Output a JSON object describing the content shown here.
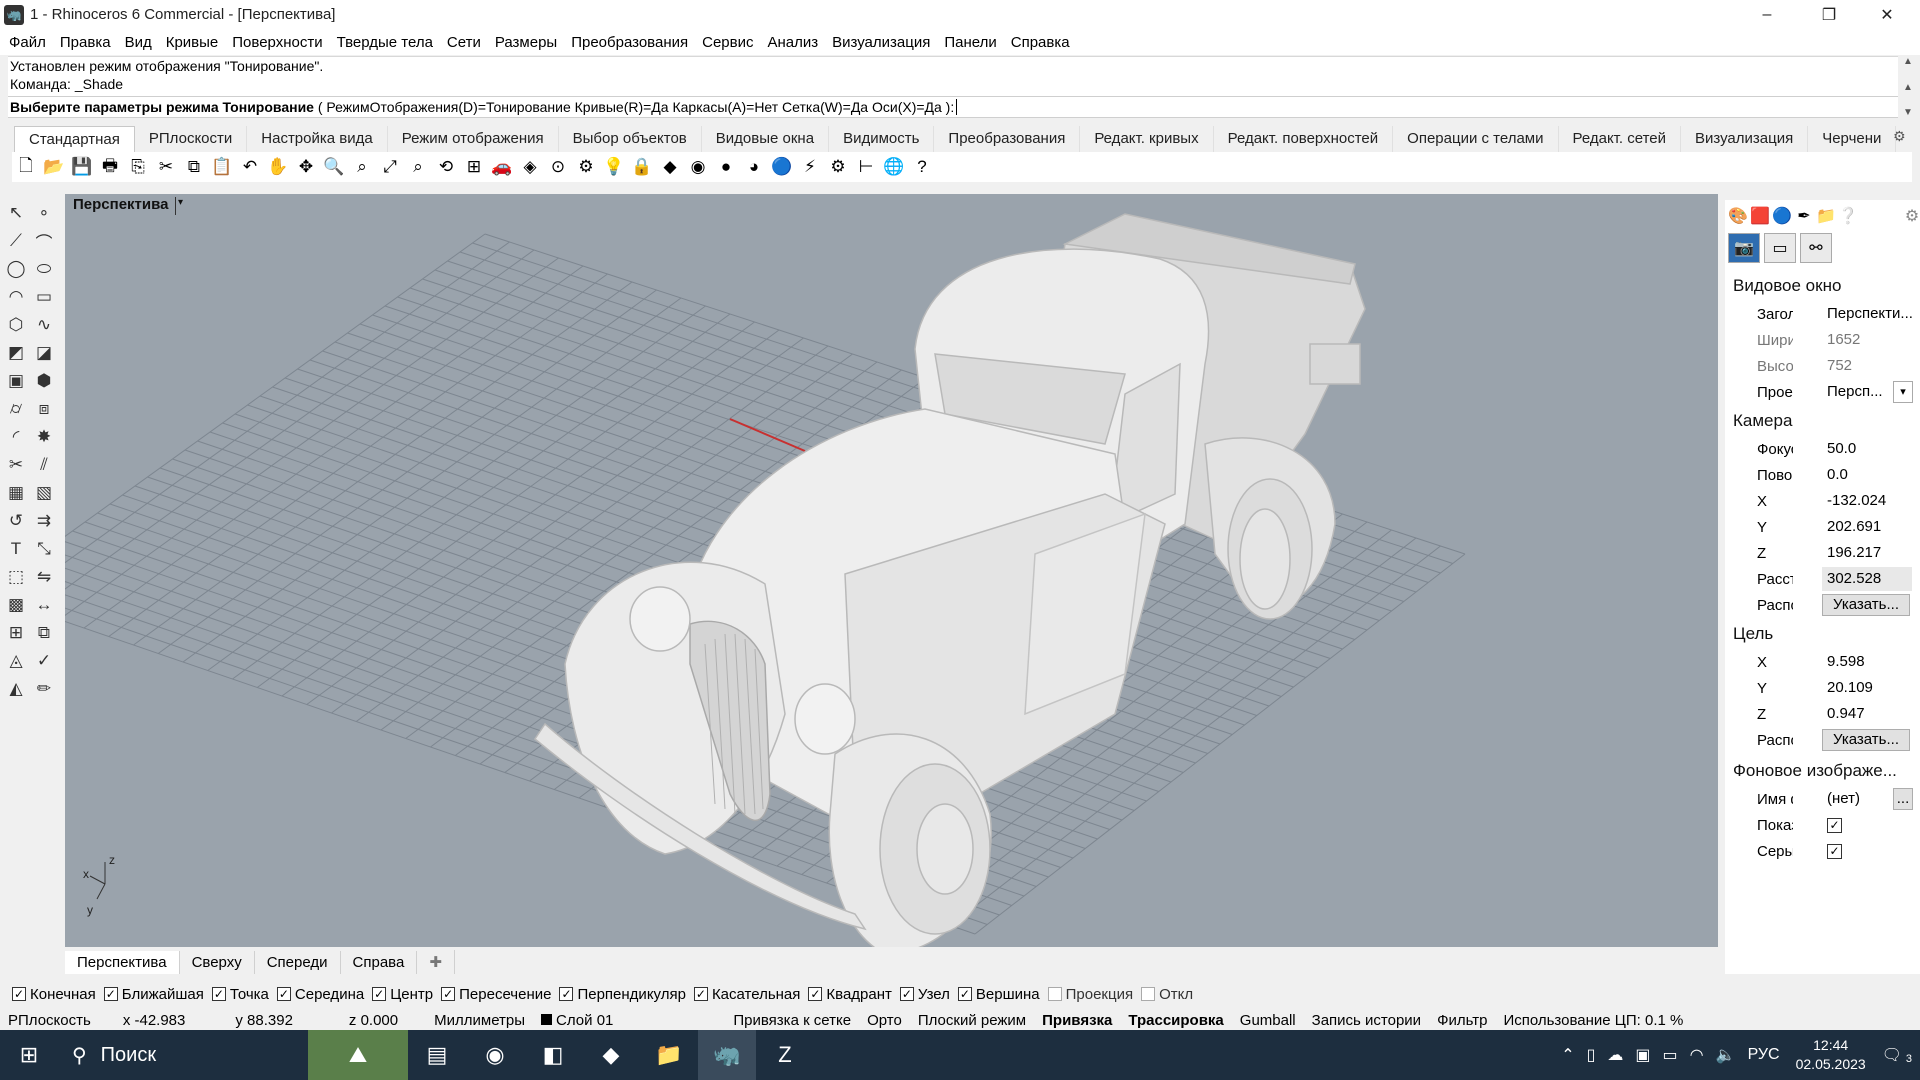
{
  "window": {
    "title": "1 - Rhinoceros 6 Commercial - [Перспектива]",
    "minimize": "–",
    "maximize": "❐",
    "close": "✕"
  },
  "menu": [
    "Файл",
    "Правка",
    "Вид",
    "Кривые",
    "Поверхности",
    "Твердые тела",
    "Сети",
    "Размеры",
    "Преобразования",
    "Сервис",
    "Анализ",
    "Визуализация",
    "Панели",
    "Справка"
  ],
  "command": {
    "history_line1": "Установлен режим отображения \"Тонирование\".",
    "history_line2": "Команда: _Shade",
    "prompt_bold": "Выберите параметры режима Тонирование",
    "prompt_options": " ( РежимОтображения(D)=Тонирование  Кривые(R)=Да  Каркасы(A)=Нет  Сетка(W)=Да  Оси(X)=Да ):"
  },
  "toolbar_tabs": [
    "Стандартная",
    "РПлоскости",
    "Настройка вида",
    "Режим отображения",
    "Выбор объектов",
    "Видовые окна",
    "Видимость",
    "Преобразования",
    "Редакт. кривых",
    "Редакт. поверхностей",
    "Операции с телами",
    "Редакт. сетей",
    "Визуализация",
    "Черчени"
  ],
  "toolbar_icons": [
    {
      "name": "new-file-icon",
      "glyph": "🗋"
    },
    {
      "name": "open-file-icon",
      "glyph": "📂"
    },
    {
      "name": "save-icon",
      "glyph": "💾"
    },
    {
      "name": "print-icon",
      "glyph": "🖶"
    },
    {
      "name": "export-icon",
      "glyph": "⎘"
    },
    {
      "name": "cut-icon",
      "glyph": "✂"
    },
    {
      "name": "copy-icon",
      "glyph": "⧉"
    },
    {
      "name": "paste-icon",
      "glyph": "📋"
    },
    {
      "name": "undo-icon",
      "glyph": "↶"
    },
    {
      "name": "pan-icon",
      "glyph": "✋"
    },
    {
      "name": "rotate-view-icon",
      "glyph": "✥"
    },
    {
      "name": "zoom-icon",
      "glyph": "🔍"
    },
    {
      "name": "zoom-window-icon",
      "glyph": "⌕"
    },
    {
      "name": "zoom-extents-icon",
      "glyph": "⤢"
    },
    {
      "name": "zoom-selected-icon",
      "glyph": "⌕"
    },
    {
      "name": "undo-view-icon",
      "glyph": "⟲"
    },
    {
      "name": "four-viewports-icon",
      "glyph": "⊞"
    },
    {
      "name": "car-icon",
      "glyph": "🚗"
    },
    {
      "name": "cplane-icon",
      "glyph": "◈"
    },
    {
      "name": "snap-icon",
      "glyph": "⊙"
    },
    {
      "name": "grid-snap-icon",
      "glyph": "⚙"
    },
    {
      "name": "light-icon",
      "glyph": "💡"
    },
    {
      "name": "lock-icon",
      "glyph": "🔒"
    },
    {
      "name": "material-icon",
      "glyph": "◆"
    },
    {
      "name": "color-wheel-icon",
      "glyph": "◉"
    },
    {
      "name": "render-sphere-icon",
      "glyph": "●"
    },
    {
      "name": "shaded-sphere-icon",
      "glyph": "◕"
    },
    {
      "name": "blue-sphere-icon",
      "glyph": "🔵"
    },
    {
      "name": "flash-icon",
      "glyph": "⚡"
    },
    {
      "name": "settings-gear-icon",
      "glyph": "⚙"
    },
    {
      "name": "dimension-icon",
      "glyph": "⊢"
    },
    {
      "name": "globe-icon",
      "glyph": "🌐"
    },
    {
      "name": "help-icon",
      "glyph": "?"
    }
  ],
  "left_tools": [
    {
      "name": "select-arrow-icon"
    },
    {
      "name": "point-icon"
    },
    {
      "name": "polyline-icon"
    },
    {
      "name": "curve-cv-icon"
    },
    {
      "name": "circle-icon"
    },
    {
      "name": "ellipse-icon"
    },
    {
      "name": "arc-icon"
    },
    {
      "name": "rectangle-icon"
    },
    {
      "name": "polygon-icon"
    },
    {
      "name": "freeform-curve-icon"
    },
    {
      "name": "surface-edge-icon"
    },
    {
      "name": "surface-loft-icon"
    },
    {
      "name": "box-solid-icon"
    },
    {
      "name": "boolean-icon"
    },
    {
      "name": "cylinder-icon"
    },
    {
      "name": "mesh-icon"
    },
    {
      "name": "fillet-icon"
    },
    {
      "name": "explode-icon"
    },
    {
      "name": "trim-icon"
    },
    {
      "name": "split-icon"
    },
    {
      "name": "group-icon"
    },
    {
      "name": "ungroup-icon"
    },
    {
      "name": "fillet-curve-icon"
    },
    {
      "name": "offset-icon"
    },
    {
      "name": "text-icon"
    },
    {
      "name": "scale-icon"
    },
    {
      "name": "transform-icon"
    },
    {
      "name": "mirror-icon"
    },
    {
      "name": "block-icon"
    },
    {
      "name": "dimension-tool-icon"
    },
    {
      "name": "array-icon"
    },
    {
      "name": "snapshot-icon"
    },
    {
      "name": "analysis-icon"
    },
    {
      "name": "check-icon"
    },
    {
      "name": "render-tool-icon"
    },
    {
      "name": "drafting-icon"
    }
  ],
  "viewport": {
    "title": "Перспектива",
    "dropdown": "▾",
    "axis_x": "x",
    "axis_y": "y",
    "axis_z": "z"
  },
  "viewport_tabs": [
    "Перспектива",
    "Сверху",
    "Спереди",
    "Справа"
  ],
  "viewport_add": "✚",
  "panel": {
    "section_viewport": "Видовое окно",
    "title_label": "Заголо...",
    "title_value": "Перспекти...",
    "width_label": "Ширина",
    "width_value": "1652",
    "height_label": "Высота",
    "height_value": "752",
    "projection_label": "Проек...",
    "projection_value": "Персп...",
    "section_camera": "Камера",
    "focal_label": "Фокусн...",
    "focal_value": "50.0",
    "rotation_label": "Поворот",
    "rotation_value": "0.0",
    "cam_x_label": "X",
    "cam_x": "-132.024",
    "cam_y_label": "Y",
    "cam_y": "202.691",
    "cam_z_label": "Z",
    "cam_z": "196.217",
    "distance_label": "Рассто...",
    "distance_value": "302.528",
    "location_label": "Распол...",
    "place_button": "Указать...",
    "section_target": "Цель",
    "tgt_x_label": "X",
    "tgt_x": "9.598",
    "tgt_y_label": "Y",
    "tgt_y": "20.109",
    "tgt_z_label": "Z",
    "tgt_z": "0.947",
    "tgt_location_label": "Распол...",
    "tgt_place_button": "Указать...",
    "section_background": "Фоновое изображе...",
    "filename_label": "Имя фа...",
    "filename_value": "(нет)",
    "browse_button": "...",
    "show_label": "Показа...",
    "gray_label": "Серый"
  },
  "osnaps": [
    {
      "label": "Конечная",
      "checked": true
    },
    {
      "label": "Ближайшая",
      "checked": true
    },
    {
      "label": "Точка",
      "checked": true
    },
    {
      "label": "Середина",
      "checked": true
    },
    {
      "label": "Центр",
      "checked": true
    },
    {
      "label": "Пересечение",
      "checked": true
    },
    {
      "label": "Перпендикуляр",
      "checked": true
    },
    {
      "label": "Касательная",
      "checked": true
    },
    {
      "label": "Квадрант",
      "checked": true
    },
    {
      "label": "Узел",
      "checked": true
    },
    {
      "label": "Вершина",
      "checked": true
    },
    {
      "label": "Проекция",
      "checked": false
    },
    {
      "label": "Откл",
      "checked": false
    }
  ],
  "status": {
    "cplane": "РПлоскость",
    "x": "x -42.983",
    "y": "y 88.392",
    "z": "z 0.000",
    "units": "Миллиметры",
    "layer": "Слой 01",
    "grid_snap": "Привязка к сетке",
    "ortho": "Орто",
    "planar": "Плоский режим",
    "osnap": "Привязка",
    "smarttrack": "Трассировка",
    "gumball": "Gumball",
    "history": "Запись истории",
    "filter": "Фильтр",
    "cpu": "Использование ЦП: 0.1 %"
  },
  "taskbar": {
    "search_placeholder": "Поиск",
    "language": "РУС",
    "time": "12:44",
    "date": "02.05.2023",
    "notifications": "3"
  },
  "colors": {
    "viewport_bg": "#9aa3ac",
    "grid_line": "#7d8690",
    "x_axis": "#c83030",
    "taskbar_bg": "#1d2e3f"
  }
}
